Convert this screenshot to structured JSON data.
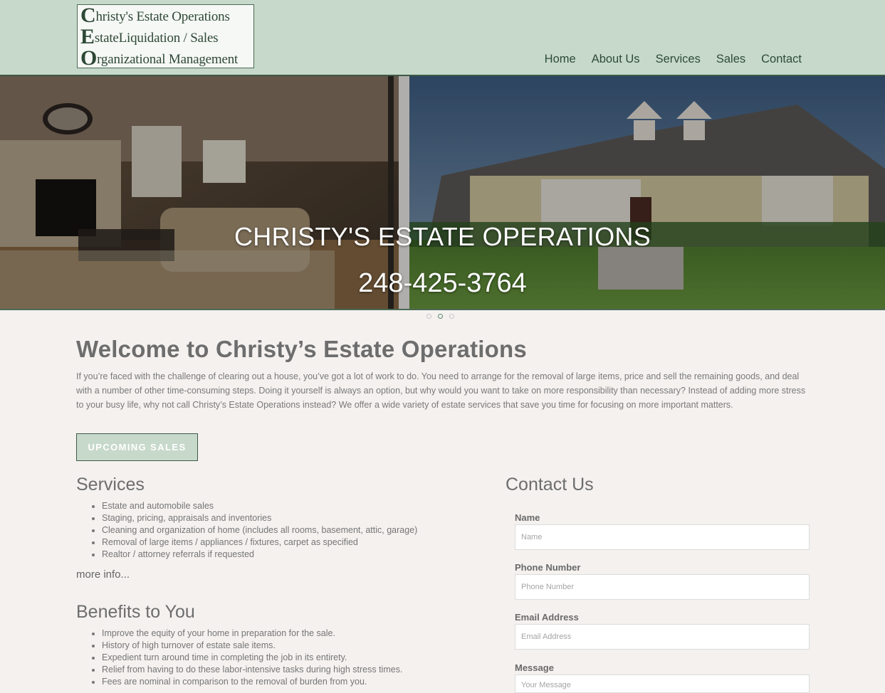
{
  "logo": {
    "line1_cap": "C",
    "line1_rest": "hristy's Estate Operations",
    "line2_cap": "E",
    "line2_rest": "stateLiquidation / Sales",
    "line3_cap": "O",
    "line3_rest": "rganizational Management"
  },
  "nav": [
    "Home",
    "About Us",
    "Services",
    "Sales",
    "Contact"
  ],
  "hero": {
    "title": "CHRISTY'S ESTATE OPERATIONS",
    "phone": "248-425-3764",
    "slide_count": 3,
    "active_slide": 2
  },
  "welcome": {
    "title": "Welcome to Christy’s Estate Operations",
    "body": "If you’re faced with the challenge of clearing out a house, you’ve got a lot of work to do. You need to arrange for the removal of large items, price and sell the remaining goods, and deal with a number of other time-consuming steps. Doing it yourself is always an option, but why would you want to take on more responsibility than necessary? Instead of adding more stress to your busy life, why not call Christy’s Estate Operations instead? We offer a wide variety of estate services that save you time for focusing on more important matters.",
    "button": "UPCOMING SALES"
  },
  "services": {
    "title": "Services",
    "items": [
      "Estate and automobile sales",
      "Staging, pricing, appraisals and inventories",
      "Cleaning and organization of home (includes all rooms, basement, attic, garage)",
      "Removal of large items / appliances / fixtures, carpet as specified",
      "Realtor / attorney referrals if requested"
    ],
    "more": "more info..."
  },
  "benefits": {
    "title": "Benefits to You",
    "items": [
      "Improve the equity of your home in preparation for the sale.",
      "History of high turnover of estate sale items.",
      "Expedient turn around time in completing the job in its entirety.",
      "Relief from having to do these labor-intensive tasks during high stress times.",
      "Fees are nominal in comparison to the removal of burden from you."
    ]
  },
  "contact": {
    "title": "Contact Us",
    "name_label": "Name",
    "name_placeholder": "Name",
    "phone_label": "Phone Number",
    "phone_placeholder": "Phone Number",
    "email_label": "Email Address",
    "email_placeholder": "Email Address",
    "message_label": "Message",
    "message_placeholder": "Your Message"
  },
  "colors": {
    "header_bg": "#c7d9cb",
    "accent_dark": "#3f5a46",
    "page_bg": "#f4f1ef"
  }
}
